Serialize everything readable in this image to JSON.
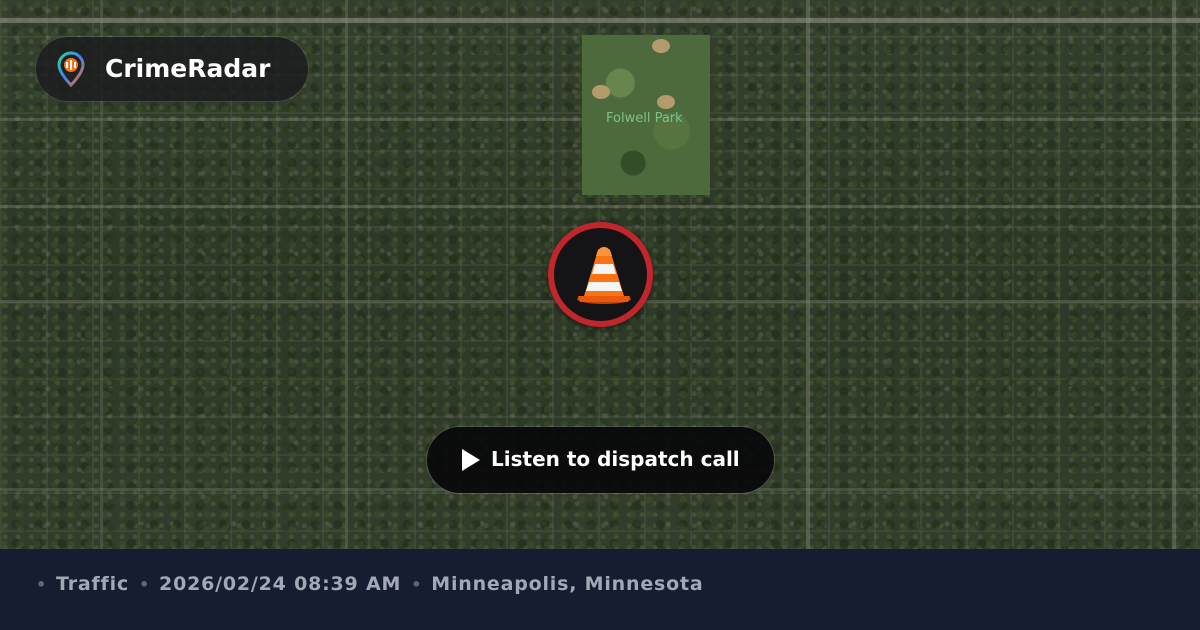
{
  "brand": {
    "name": "CrimeRadar",
    "logo_icon": "radar-pin-icon"
  },
  "map": {
    "park_label": "Folwell Park",
    "marker_icon": "traffic-cone-icon",
    "marker_ring_color": "#c0262b"
  },
  "player": {
    "icon": "play-icon",
    "label": "Listen to dispatch call"
  },
  "footer": {
    "separator": "•",
    "category": "Traffic",
    "datetime": "2026/02/24 08:39 AM",
    "location": "Minneapolis, Minnesota"
  }
}
